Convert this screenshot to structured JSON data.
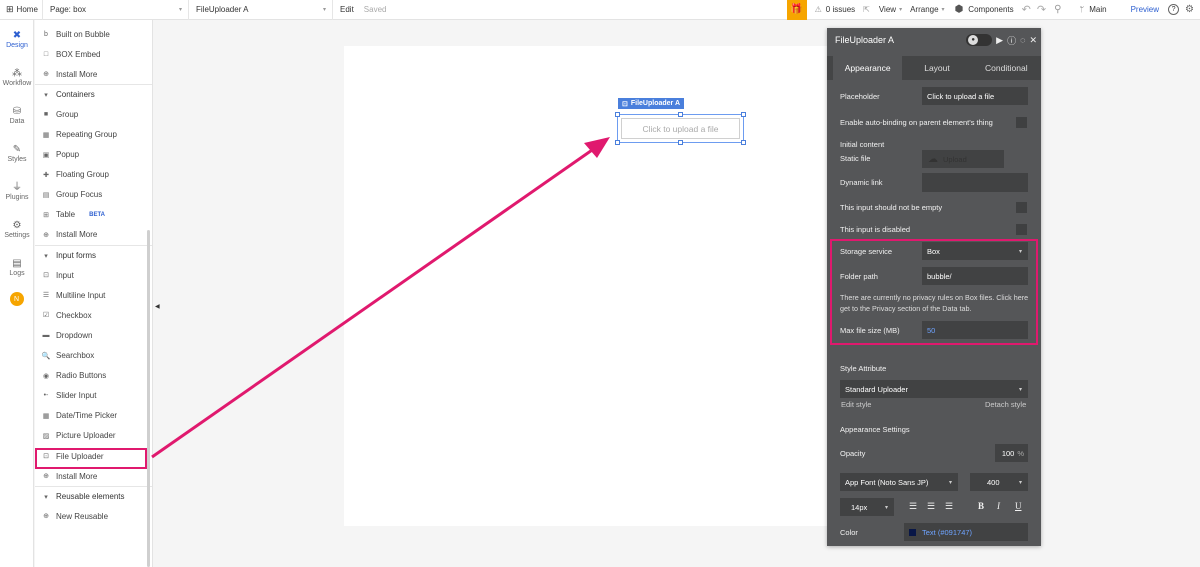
{
  "topbar": {
    "home": "Home",
    "page": "Page: box",
    "element": "FileUploader A",
    "edit": "Edit",
    "saved": "Saved",
    "issues": "0 issues",
    "view": "View",
    "arrange": "Arrange",
    "components": "Components",
    "branch": "Main",
    "preview": "Preview"
  },
  "rail": {
    "items": [
      {
        "label": "Design",
        "icon": "design-icon"
      },
      {
        "label": "Workflow",
        "icon": "workflow-icon"
      },
      {
        "label": "Data",
        "icon": "data-icon"
      },
      {
        "label": "Styles",
        "icon": "styles-icon"
      },
      {
        "label": "Plugins",
        "icon": "plugins-icon"
      },
      {
        "label": "Settings",
        "icon": "settings-icon"
      },
      {
        "label": "Logs",
        "icon": "logs-icon"
      }
    ],
    "avatar": "N"
  },
  "elements": {
    "rows": [
      {
        "label": "Built on Bubble",
        "icon": "b"
      },
      {
        "label": "BOX Embed",
        "icon": "□"
      },
      {
        "label": "Install More",
        "icon": "⊕"
      },
      {
        "label": "Containers",
        "icon": "▾",
        "section": true
      },
      {
        "label": "Group",
        "icon": "■"
      },
      {
        "label": "Repeating Group",
        "icon": "▦"
      },
      {
        "label": "Popup",
        "icon": "▣"
      },
      {
        "label": "Floating Group",
        "icon": "✚"
      },
      {
        "label": "Group Focus",
        "icon": "▤"
      },
      {
        "label": "Table",
        "icon": "⊞",
        "badge": "BETA"
      },
      {
        "label": "Install More",
        "icon": "⊕"
      },
      {
        "label": "Input forms",
        "icon": "▾",
        "section": true
      },
      {
        "label": "Input",
        "icon": "⊡"
      },
      {
        "label": "Multiline Input",
        "icon": "☰"
      },
      {
        "label": "Checkbox",
        "icon": "☑"
      },
      {
        "label": "Dropdown",
        "icon": "▬"
      },
      {
        "label": "Searchbox",
        "icon": "🔍"
      },
      {
        "label": "Radio Buttons",
        "icon": "◉"
      },
      {
        "label": "Slider Input",
        "icon": "•-"
      },
      {
        "label": "Date/Time Picker",
        "icon": "▦"
      },
      {
        "label": "Picture Uploader",
        "icon": "▨"
      },
      {
        "label": "File Uploader",
        "icon": "⊡"
      },
      {
        "label": "Install More",
        "icon": "⊕"
      },
      {
        "label": "Reusable elements",
        "icon": "▾",
        "section": true
      },
      {
        "label": "New Reusable",
        "icon": "⊕"
      }
    ]
  },
  "canvas": {
    "tag": "FileUploader A",
    "placeholder": "Click to upload a file"
  },
  "editor": {
    "title": "FileUploader A",
    "tabs": [
      "Appearance",
      "Layout",
      "Conditional"
    ],
    "placeholder_label": "Placeholder",
    "placeholder_value": "Click to upload a file",
    "autobinding_label": "Enable auto-binding on parent element's thing",
    "initial_content_label": "Initial content",
    "static_file_label": "Static file",
    "upload_label": "Upload",
    "dynamic_link_label": "Dynamic link",
    "not_empty_label": "This input should not be empty",
    "disabled_label": "This input is disabled",
    "storage_label": "Storage service",
    "storage_value": "Box",
    "folder_label": "Folder path",
    "folder_value": "bubble/",
    "privacy_note": "There are currently no privacy rules on Box files. Click here get to the Privacy section of the Data tab.",
    "max_size_label": "Max file size (MB)",
    "max_size_value": "50",
    "style_attr_label": "Style Attribute",
    "style_value": "Standard Uploader",
    "edit_style": "Edit style",
    "detach_style": "Detach style",
    "appearance_settings": "Appearance Settings",
    "opacity_label": "Opacity",
    "opacity_value": "100",
    "opacity_unit": "%",
    "font_value": "App Font (Noto Sans JP)",
    "weight_value": "400",
    "size_value": "14px",
    "color_label": "Color",
    "color_value": "Text (#091747)"
  },
  "colors": {
    "highlight": "#e0196e",
    "accent": "#2d5fd0",
    "editor_bg": "#555658"
  }
}
